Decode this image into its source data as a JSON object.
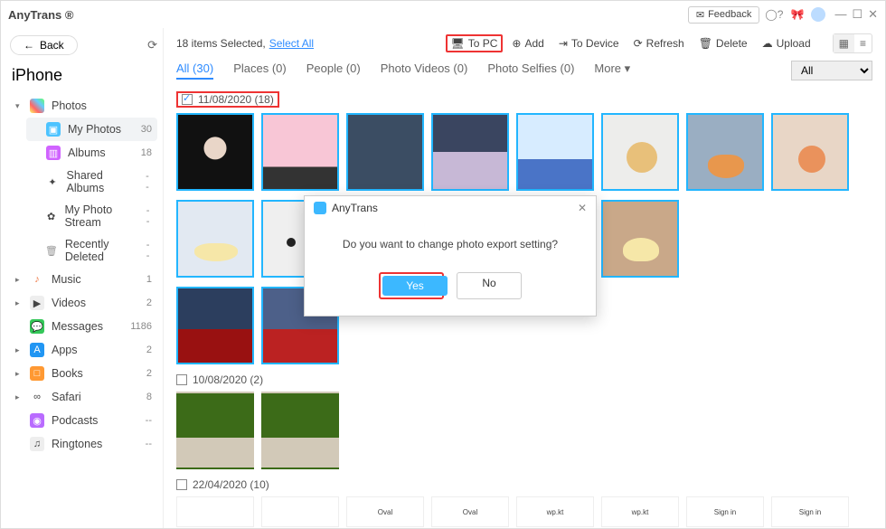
{
  "app": {
    "title": "AnyTrans ®",
    "feedback": "Feedback"
  },
  "win": {
    "min": "—",
    "max": "☐",
    "close": "✕"
  },
  "back": {
    "label": "Back"
  },
  "device": "iPhone",
  "sidebar": [
    {
      "caret": "▾",
      "icon": "ic-photos",
      "name": "photos",
      "label": "Photos",
      "count": "",
      "sub": true
    },
    {
      "caret": "",
      "icon": "ic-myphotos",
      "name": "my-photos",
      "label": "My Photos",
      "count": "30",
      "sub": true,
      "active": true,
      "indent": true
    },
    {
      "caret": "",
      "icon": "ic-albums",
      "name": "albums",
      "label": "Albums",
      "count": "18",
      "sub": true,
      "indent": true
    },
    {
      "caret": "",
      "icon": "ic-shared",
      "name": "shared-albums",
      "label": "Shared Albums",
      "count": "--",
      "sub": true,
      "indent": true
    },
    {
      "caret": "",
      "icon": "ic-stream",
      "name": "photo-stream",
      "label": "My Photo Stream",
      "count": "--",
      "sub": true,
      "indent": true
    },
    {
      "caret": "",
      "icon": "ic-deleted",
      "name": "recently-deleted",
      "label": "Recently Deleted",
      "count": "--",
      "sub": true,
      "indent": true
    },
    {
      "caret": "▸",
      "icon": "ic-music",
      "name": "music",
      "label": "Music",
      "count": "1"
    },
    {
      "caret": "▸",
      "icon": "ic-videos",
      "name": "videos",
      "label": "Videos",
      "count": "2"
    },
    {
      "caret": "",
      "icon": "ic-messages",
      "name": "messages",
      "label": "Messages",
      "count": "1186"
    },
    {
      "caret": "▸",
      "icon": "ic-apps",
      "name": "apps",
      "label": "Apps",
      "count": "2"
    },
    {
      "caret": "▸",
      "icon": "ic-books",
      "name": "books",
      "label": "Books",
      "count": "2"
    },
    {
      "caret": "▸",
      "icon": "ic-safari",
      "name": "safari",
      "label": "Safari",
      "count": "8"
    },
    {
      "caret": "",
      "icon": "ic-podcasts",
      "name": "podcasts",
      "label": "Podcasts",
      "count": "--"
    },
    {
      "caret": "",
      "icon": "ic-ringtones",
      "name": "ringtones",
      "label": "Ringtones",
      "count": "--"
    }
  ],
  "toolbar": {
    "selected": "18 items Selected, ",
    "selectAll": "Select All",
    "toPC": "To PC",
    "add": "Add",
    "toDevice": "To Device",
    "refresh": "Refresh",
    "delete": "Delete",
    "upload": "Upload"
  },
  "tabs": [
    {
      "label": "All (30)",
      "active": true
    },
    {
      "label": "Places (0)"
    },
    {
      "label": "People (0)"
    },
    {
      "label": "Photo Videos (0)"
    },
    {
      "label": "Photo Selfies (0)"
    },
    {
      "label": "More ▾"
    }
  ],
  "filter": {
    "selected": "All"
  },
  "groups": [
    {
      "date": "11/08/2020 (18)",
      "checked": true,
      "highlight": true,
      "thumbs": [
        "t1",
        "t2",
        "t3",
        "t4",
        "t5",
        "t6",
        "t7",
        "t8",
        "t9",
        "t10",
        "t11",
        "t12",
        "t13",
        "t14"
      ],
      "thumbsRow2": [
        "t15",
        "t16"
      ],
      "allSelected": true
    },
    {
      "date": "10/08/2020 (2)",
      "checked": false,
      "thumbs2": [
        "tTree",
        "tTree"
      ]
    },
    {
      "date": "22/04/2020 (10)",
      "checked": false,
      "cards": [
        "",
        "",
        "Oval",
        "Oval",
        "wp.kt",
        "wp.kt",
        "Sign in",
        "Sign in"
      ]
    }
  ],
  "dialog": {
    "title": "AnyTrans",
    "message": "Do you want to change photo export setting?",
    "yes": "Yes",
    "no": "No"
  }
}
